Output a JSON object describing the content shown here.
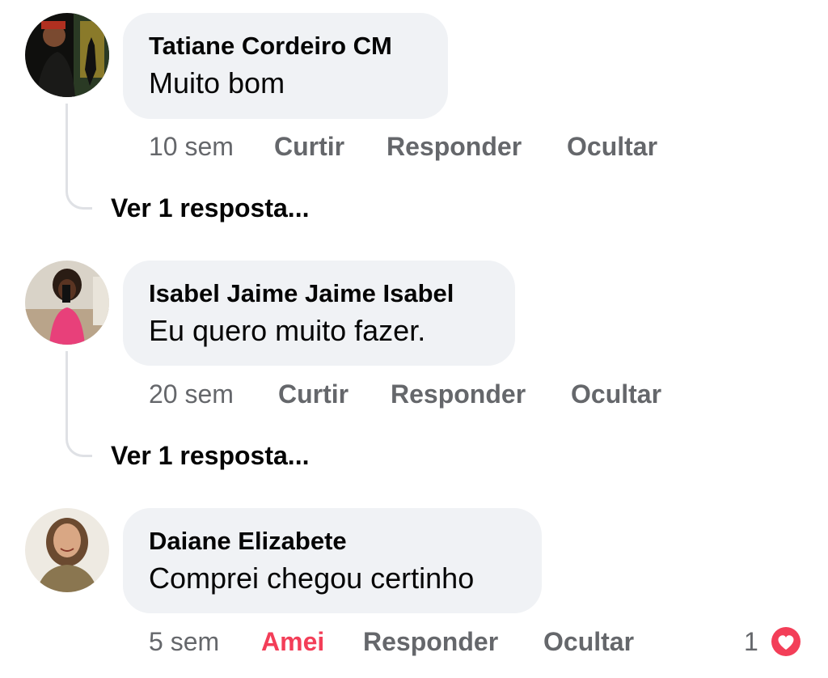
{
  "comments": [
    {
      "author": "Tatiane Cordeiro CM",
      "text": "Muito bom",
      "time": "10 sem",
      "like_label": "Curtir",
      "reply_label": "Responder",
      "hide_label": "Ocultar",
      "view_replies": "Ver 1 resposta..."
    },
    {
      "author": "Isabel Jaime Jaime Isabel",
      "text": "Eu quero muito fazer.",
      "time": "20 sem",
      "like_label": "Curtir",
      "reply_label": "Responder",
      "hide_label": "Ocultar",
      "view_replies": "Ver 1 resposta..."
    },
    {
      "author": "Daiane Elizabete",
      "text": "Comprei chegou certinho",
      "time": "5 sem",
      "like_label": "Amei",
      "reply_label": "Responder",
      "hide_label": "Ocultar",
      "reaction_count": "1",
      "reaction_icon": "heart-icon"
    }
  ],
  "colors": {
    "bubble": "#f0f2f5",
    "secondary_text": "#65676b",
    "love_reaction": "#f33e58"
  }
}
